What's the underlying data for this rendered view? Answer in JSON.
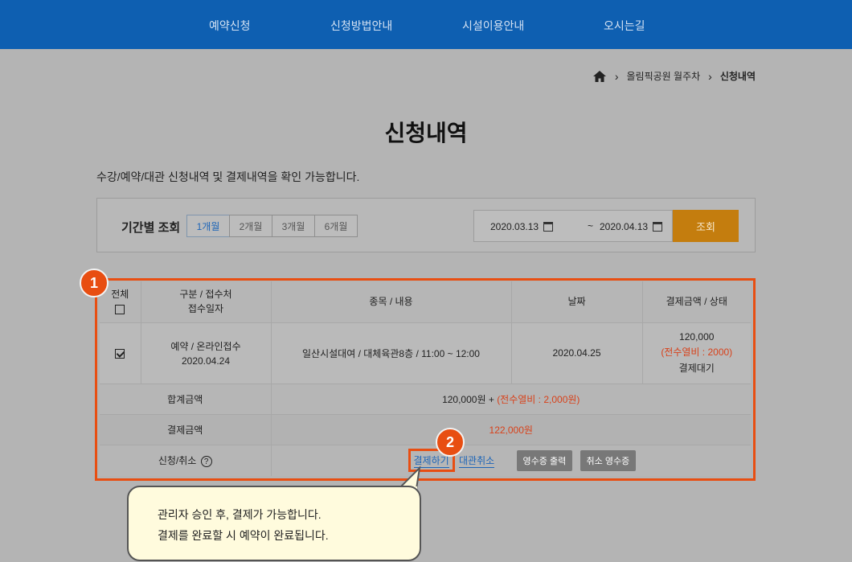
{
  "nav": {
    "items": [
      "예약신청",
      "신청방법안내",
      "시설이용안내",
      "오시는길"
    ]
  },
  "breadcrumb": {
    "home_icon": "home-icon",
    "items": [
      "올림픽공원 월주차",
      "신청내역"
    ]
  },
  "page": {
    "title": "신청내역",
    "description": "수강/예약/대관 신청내역 및 결제내역을 확인 가능합니다."
  },
  "period": {
    "label": "기간별 조회",
    "options": [
      "1개월",
      "2개월",
      "3개월",
      "6개월"
    ],
    "selected": "1개월",
    "start_date": "2020.03.13",
    "tilde": "~",
    "end_date": "2020.04.13",
    "search_label": "조회"
  },
  "table": {
    "headers": {
      "all": "전체",
      "type_line1": "구분 / 접수처",
      "type_line2": "접수일자",
      "content": "종목 / 내용",
      "date": "날짜",
      "amount": "결제금액 / 상태"
    },
    "row": {
      "type_line1": "예약 / 온라인접수",
      "type_line2": "2020.04.24",
      "content": "일산시설대여 / 대체육관8층 / 11:00 ~ 12:00",
      "date": "2020.04.25",
      "amount": "120,000",
      "fee": "(전수열비 : 2000)",
      "status": "결제대기"
    },
    "total_label": "합계금액",
    "total_value": "120,000원 +",
    "total_fee": "(전수열비 : 2,000원)",
    "pay_label": "결제금액",
    "pay_value": "122,000원",
    "action_label": "신청/취소",
    "action_help_icon": "?",
    "pay_button": "결제하기",
    "cancel_link": "대관취소",
    "receipt_button": "영수증 출력",
    "cancel_receipt_button": "취소 영수증"
  },
  "badges": [
    "1",
    "2"
  ],
  "tooltip": {
    "line1": "관리자 승인 후, 결제가 가능합니다.",
    "line2": "결제를 완료할 시 예약이 완료됩니다."
  }
}
